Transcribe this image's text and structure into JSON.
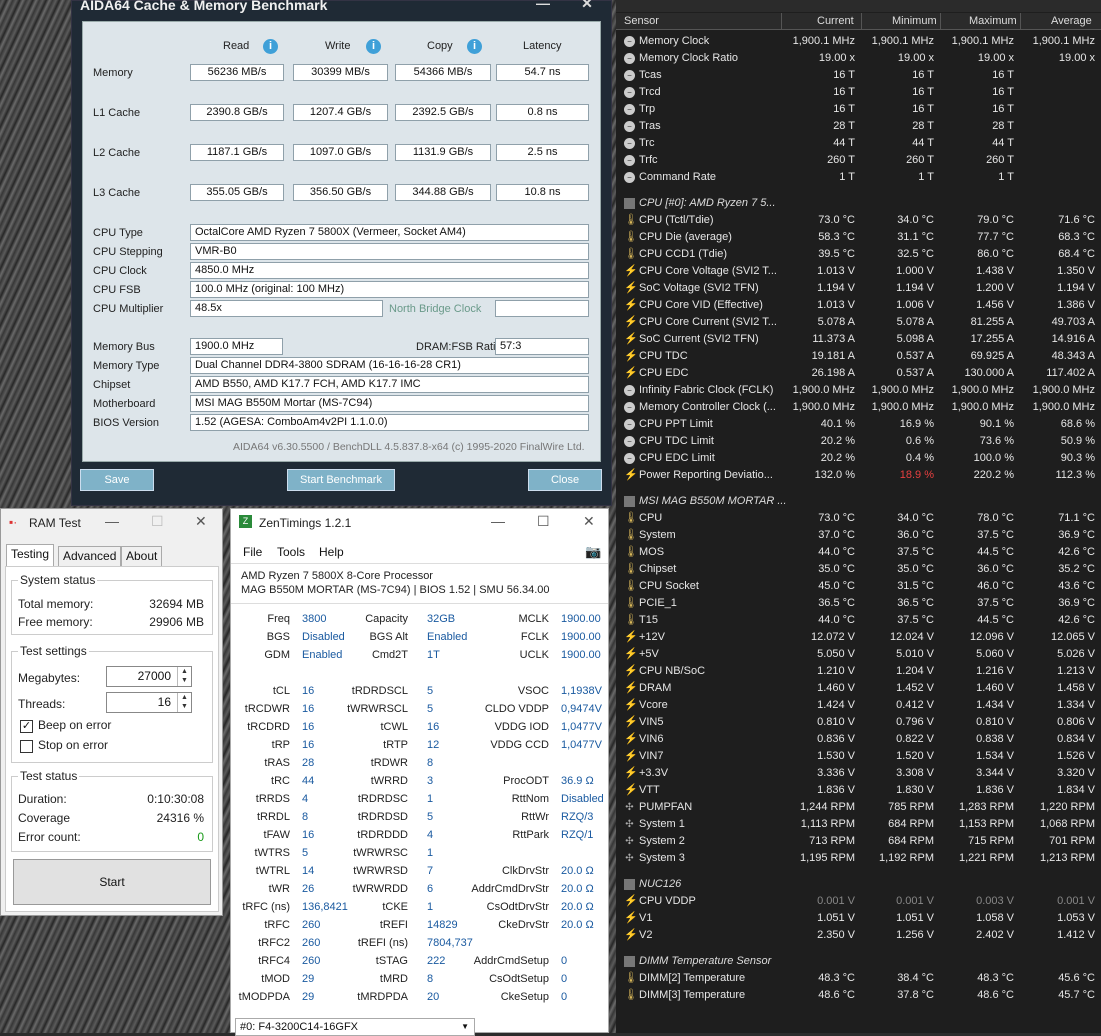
{
  "aida": {
    "title": "AIDA64 Cache & Memory Benchmark",
    "headers": {
      "read": "Read",
      "write": "Write",
      "copy": "Copy",
      "latency": "Latency"
    },
    "bench": [
      {
        "label": "Memory",
        "read": "56236 MB/s",
        "write": "30399 MB/s",
        "copy": "54366 MB/s",
        "latency": "54.7 ns"
      },
      {
        "label": "L1 Cache",
        "read": "2390.8 GB/s",
        "write": "1207.4 GB/s",
        "copy": "2392.5 GB/s",
        "latency": "0.8 ns"
      },
      {
        "label": "L2 Cache",
        "read": "1187.1 GB/s",
        "write": "1097.0 GB/s",
        "copy": "1131.9 GB/s",
        "latency": "2.5 ns"
      },
      {
        "label": "L3 Cache",
        "read": "355.05 GB/s",
        "write": "356.50 GB/s",
        "copy": "344.88 GB/s",
        "latency": "10.8 ns"
      }
    ],
    "cpu": [
      {
        "label": "CPU Type",
        "value": "OctalCore AMD Ryzen 7 5800X  (Vermeer, Socket AM4)"
      },
      {
        "label": "CPU Stepping",
        "value": "VMR-B0"
      },
      {
        "label": "CPU Clock",
        "value": "4850.0 MHz"
      },
      {
        "label": "CPU FSB",
        "value": "100.0 MHz  (original: 100 MHz)"
      },
      {
        "label": "CPU Multiplier",
        "value": "48.5x"
      }
    ],
    "nb_clock_label": "North Bridge Clock",
    "mem_bus_label": "Memory Bus",
    "mem_bus": "1900.0 MHz",
    "dram_ratio_label": "DRAM:FSB Ratio",
    "dram_ratio": "57:3",
    "sys": [
      {
        "label": "Memory Type",
        "value": "Dual Channel DDR4-3800 SDRAM  (16-16-16-28 CR1)"
      },
      {
        "label": "Chipset",
        "value": "AMD B550, AMD K17.7 FCH, AMD K17.7 IMC"
      },
      {
        "label": "Motherboard",
        "value": "MSI MAG B550M Mortar (MS-7C94)"
      },
      {
        "label": "BIOS Version",
        "value": "1.52  (AGESA: ComboAm4v2PI 1.1.0.0)"
      }
    ],
    "footer": "AIDA64 v6.30.5500 / BenchDLL 4.5.837.8-x64  (c) 1995-2020 FinalWire Ltd.",
    "btn_save": "Save",
    "btn_start": "Start Benchmark",
    "btn_close": "Close"
  },
  "ramtest": {
    "title": "RAM Test",
    "tabs": [
      "Testing",
      "Advanced",
      "About"
    ],
    "system_status": "System status",
    "total_label": "Total memory:",
    "total": "32694 MB",
    "free_label": "Free memory:",
    "free": "29906 MB",
    "test_settings": "Test settings",
    "mb_label": "Megabytes:",
    "mb": "27000",
    "threads_label": "Threads:",
    "threads": "16",
    "beep": "Beep on error",
    "stop": "Stop on error",
    "test_status": "Test status",
    "duration_label": "Duration:",
    "duration": "0:10:30:08",
    "coverage_label": "Coverage",
    "coverage": "24316 %",
    "errors_label": "Error count:",
    "errors": "0",
    "start": "Start"
  },
  "zen": {
    "title": "ZenTimings 1.2.1",
    "menu": [
      "File",
      "Tools",
      "Help"
    ],
    "cpu": "AMD Ryzen 7 5800X 8-Core Processor",
    "board": "MAG B550M MORTAR (MS-7C94) | BIOS 1.52 | SMU 56.34.00",
    "col1": [
      [
        "Freq",
        "3800"
      ],
      [
        "BGS",
        "Disabled"
      ],
      [
        "GDM",
        "Enabled"
      ],
      [
        "tCL",
        "16"
      ],
      [
        "tRCDWR",
        "16"
      ],
      [
        "tRCDRD",
        "16"
      ],
      [
        "tRP",
        "16"
      ],
      [
        "tRAS",
        "28"
      ],
      [
        "tRC",
        "44"
      ],
      [
        "tRRDS",
        "4"
      ],
      [
        "tRRDL",
        "8"
      ],
      [
        "tFAW",
        "16"
      ],
      [
        "tWTRS",
        "5"
      ],
      [
        "tWTRL",
        "14"
      ],
      [
        "tWR",
        "26"
      ],
      [
        "tRFC (ns)",
        "136,8421"
      ],
      [
        "tRFC",
        "260"
      ],
      [
        "tRFC2",
        "260"
      ],
      [
        "tRFC4",
        "260"
      ],
      [
        "tMOD",
        "29"
      ],
      [
        "tMODPDA",
        "29"
      ]
    ],
    "col2": [
      [
        "Capacity",
        "32GB"
      ],
      [
        "BGS Alt",
        "Enabled"
      ],
      [
        "Cmd2T",
        "1T"
      ],
      [
        "tRDRDSCL",
        "5"
      ],
      [
        "tWRWRSCL",
        "5"
      ],
      [
        "tCWL",
        "16"
      ],
      [
        "tRTP",
        "12"
      ],
      [
        "tRDWR",
        "8"
      ],
      [
        "tWRRD",
        "3"
      ],
      [
        "tRDRDSC",
        "1"
      ],
      [
        "tRDRDSD",
        "5"
      ],
      [
        "tRDRDDD",
        "4"
      ],
      [
        "tWRWRSC",
        "1"
      ],
      [
        "tWRWRSD",
        "7"
      ],
      [
        "tWRWRDD",
        "6"
      ],
      [
        "tCKE",
        "1"
      ],
      [
        "tREFI",
        "14829"
      ],
      [
        "tREFI (ns)",
        "7804,737"
      ],
      [
        "tSTAG",
        "222"
      ],
      [
        "tMRD",
        "8"
      ],
      [
        "tMRDPDA",
        "20"
      ]
    ],
    "col3": [
      [
        "MCLK",
        "1900.00"
      ],
      [
        "FCLK",
        "1900.00"
      ],
      [
        "UCLK",
        "1900.00"
      ],
      [
        "VSOC",
        "1,1938V"
      ],
      [
        "CLDO VDDP",
        "0,9474V"
      ],
      [
        "VDDG IOD",
        "1,0477V"
      ],
      [
        "VDDG CCD",
        "1,0477V"
      ],
      [
        "ProcODT",
        "36.9 Ω"
      ],
      [
        "RttNom",
        "Disabled"
      ],
      [
        "RttWr",
        "RZQ/3"
      ],
      [
        "RttPark",
        "RZQ/1"
      ],
      [
        "ClkDrvStr",
        "20.0 Ω"
      ],
      [
        "AddrCmdDrvStr",
        "20.0 Ω"
      ],
      [
        "CsOdtDrvStr",
        "20.0 Ω"
      ],
      [
        "CkeDrvStr",
        "20.0 Ω"
      ],
      [
        "AddrCmdSetup",
        "0"
      ],
      [
        "CsOdtSetup",
        "0"
      ],
      [
        "CkeSetup",
        "0"
      ]
    ],
    "profile": "#0: F4-3200C14-16GFX"
  },
  "hw": {
    "columns": [
      "Sensor",
      "Current",
      "Minimum",
      "Maximum",
      "Average"
    ],
    "sections": [
      {
        "group": "",
        "rows": [
          [
            "c",
            "Memory Clock",
            "1,900.1 MHz",
            "1,900.1 MHz",
            "1,900.1 MHz",
            "1,900.1 MHz"
          ],
          [
            "c",
            "Memory Clock Ratio",
            "19.00 x",
            "19.00 x",
            "19.00 x",
            "19.00 x"
          ],
          [
            "c",
            "Tcas",
            "16 T",
            "16 T",
            "16 T",
            ""
          ],
          [
            "c",
            "Trcd",
            "16 T",
            "16 T",
            "16 T",
            ""
          ],
          [
            "c",
            "Trp",
            "16 T",
            "16 T",
            "16 T",
            ""
          ],
          [
            "c",
            "Tras",
            "28 T",
            "28 T",
            "28 T",
            ""
          ],
          [
            "c",
            "Trc",
            "44 T",
            "44 T",
            "44 T",
            ""
          ],
          [
            "c",
            "Trfc",
            "260 T",
            "260 T",
            "260 T",
            ""
          ],
          [
            "c",
            "Command Rate",
            "1 T",
            "1 T",
            "1 T",
            ""
          ]
        ]
      },
      {
        "group": "CPU [#0]: AMD Ryzen 7 5...",
        "rows": [
          [
            "t",
            "CPU (Tctl/Tdie)",
            "73.0 °C",
            "34.0 °C",
            "79.0 °C",
            "71.6 °C"
          ],
          [
            "t",
            "CPU Die (average)",
            "58.3 °C",
            "31.1 °C",
            "77.7 °C",
            "68.3 °C"
          ],
          [
            "t",
            "CPU CCD1 (Tdie)",
            "39.5 °C",
            "32.5 °C",
            "86.0 °C",
            "68.4 °C"
          ],
          [
            "v",
            "CPU Core Voltage (SVI2 T...",
            "1.013 V",
            "1.000 V",
            "1.438 V",
            "1.350 V"
          ],
          [
            "v",
            "SoC Voltage (SVI2 TFN)",
            "1.194 V",
            "1.194 V",
            "1.200 V",
            "1.194 V"
          ],
          [
            "v",
            "CPU Core VID (Effective)",
            "1.013 V",
            "1.006 V",
            "1.456 V",
            "1.386 V"
          ],
          [
            "v",
            "CPU Core Current (SVI2 T...",
            "5.078 A",
            "5.078 A",
            "81.255 A",
            "49.703 A"
          ],
          [
            "v",
            "SoC Current (SVI2 TFN)",
            "11.373 A",
            "5.098 A",
            "17.255 A",
            "14.916 A"
          ],
          [
            "v",
            "CPU TDC",
            "19.181 A",
            "0.537 A",
            "69.925 A",
            "48.343 A"
          ],
          [
            "v",
            "CPU EDC",
            "26.198 A",
            "0.537 A",
            "130.000 A",
            "117.402 A"
          ],
          [
            "c",
            "Infinity Fabric Clock (FCLK)",
            "1,900.0 MHz",
            "1,900.0 MHz",
            "1,900.0 MHz",
            "1,900.0 MHz"
          ],
          [
            "c",
            "Memory Controller Clock (...",
            "1,900.0 MHz",
            "1,900.0 MHz",
            "1,900.0 MHz",
            "1,900.0 MHz"
          ],
          [
            "c",
            "CPU PPT Limit",
            "40.1 %",
            "16.9 %",
            "90.1 %",
            "68.6 %"
          ],
          [
            "c",
            "CPU TDC Limit",
            "20.2 %",
            "0.6 %",
            "73.6 %",
            "50.9 %"
          ],
          [
            "c",
            "CPU EDC Limit",
            "20.2 %",
            "0.4 %",
            "100.0 %",
            "90.3 %"
          ],
          [
            "v",
            "Power Reporting Deviatio...",
            "132.0 %",
            "18.9 %",
            "220.2 %",
            "112.3 %"
          ]
        ]
      },
      {
        "group": "MSI MAG B550M MORTAR ...",
        "rows": [
          [
            "t",
            "CPU",
            "73.0 °C",
            "34.0 °C",
            "78.0 °C",
            "71.1 °C"
          ],
          [
            "t",
            "System",
            "37.0 °C",
            "36.0 °C",
            "37.5 °C",
            "36.9 °C"
          ],
          [
            "t",
            "MOS",
            "44.0 °C",
            "37.5 °C",
            "44.5 °C",
            "42.6 °C"
          ],
          [
            "t",
            "Chipset",
            "35.0 °C",
            "35.0 °C",
            "36.0 °C",
            "35.2 °C"
          ],
          [
            "t",
            "CPU Socket",
            "45.0 °C",
            "31.5 °C",
            "46.0 °C",
            "43.6 °C"
          ],
          [
            "t",
            "PCIE_1",
            "36.5 °C",
            "36.5 °C",
            "37.5 °C",
            "36.9 °C"
          ],
          [
            "t",
            "T15",
            "44.0 °C",
            "37.5 °C",
            "44.5 °C",
            "42.6 °C"
          ],
          [
            "v",
            "+12V",
            "12.072 V",
            "12.024 V",
            "12.096 V",
            "12.065 V"
          ],
          [
            "v",
            "+5V",
            "5.050 V",
            "5.010 V",
            "5.060 V",
            "5.026 V"
          ],
          [
            "v",
            "CPU NB/SoC",
            "1.210 V",
            "1.204 V",
            "1.216 V",
            "1.213 V"
          ],
          [
            "v",
            "DRAM",
            "1.460 V",
            "1.452 V",
            "1.460 V",
            "1.458 V"
          ],
          [
            "v",
            "Vcore",
            "1.424 V",
            "0.412 V",
            "1.434 V",
            "1.334 V"
          ],
          [
            "v",
            "VIN5",
            "0.810 V",
            "0.796 V",
            "0.810 V",
            "0.806 V"
          ],
          [
            "v",
            "VIN6",
            "0.836 V",
            "0.822 V",
            "0.838 V",
            "0.834 V"
          ],
          [
            "v",
            "VIN7",
            "1.530 V",
            "1.520 V",
            "1.534 V",
            "1.526 V"
          ],
          [
            "v",
            "+3.3V",
            "3.336 V",
            "3.308 V",
            "3.344 V",
            "3.320 V"
          ],
          [
            "v",
            "VTT",
            "1.836 V",
            "1.830 V",
            "1.836 V",
            "1.834 V"
          ],
          [
            "f",
            "PUMPFAN",
            "1,244 RPM",
            "785 RPM",
            "1,283 RPM",
            "1,220 RPM"
          ],
          [
            "f",
            "System 1",
            "1,113 RPM",
            "684 RPM",
            "1,153 RPM",
            "1,068 RPM"
          ],
          [
            "f",
            "System 2",
            "713 RPM",
            "684 RPM",
            "715 RPM",
            "701 RPM"
          ],
          [
            "f",
            "System 3",
            "1,195 RPM",
            "1,192 RPM",
            "1,221 RPM",
            "1,213 RPM"
          ]
        ]
      },
      {
        "group": "NUC126",
        "rows": [
          [
            "v",
            "CPU VDDP",
            "0.001 V",
            "0.001 V",
            "0.003 V",
            "0.001 V"
          ],
          [
            "v",
            "V1",
            "1.051 V",
            "1.051 V",
            "1.058 V",
            "1.053 V"
          ],
          [
            "v",
            "V2",
            "2.350 V",
            "1.256 V",
            "2.402 V",
            "1.412 V"
          ]
        ]
      },
      {
        "group": "DIMM Temperature Sensor",
        "rows": [
          [
            "t",
            "DIMM[2] Temperature",
            "48.3 °C",
            "38.4 °C",
            "48.3 °C",
            "45.6 °C"
          ],
          [
            "t",
            "DIMM[3] Temperature",
            "48.6 °C",
            "37.8 °C",
            "48.6 °C",
            "45.7 °C"
          ]
        ]
      }
    ]
  }
}
